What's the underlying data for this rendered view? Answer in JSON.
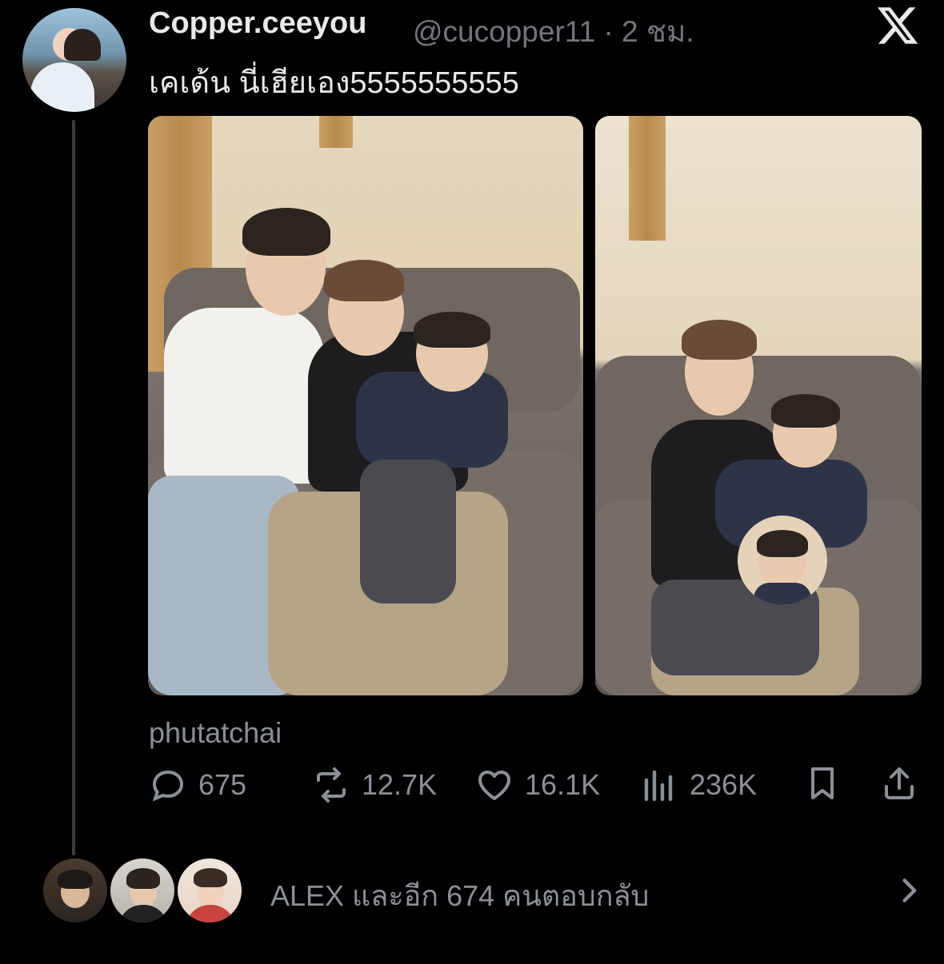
{
  "tweet": {
    "display_name": "Copper.ceeyou",
    "handle_time": "@cucopper11 · 2 ชม.",
    "text": "เคเด้น นี่เฮียเอง5555555555",
    "photo_credit": "phutatchai"
  },
  "actions": {
    "replies": "675",
    "reposts": "12.7K",
    "likes": "16.1K",
    "views": "236K"
  },
  "reply_summary": {
    "text": "ALEX และอีก 674 คนตอบกลับ"
  },
  "icons": {
    "platform": "x-logo-icon",
    "reply": "speech-bubble-icon",
    "repost": "repost-arrows-icon",
    "like": "heart-icon",
    "views": "bar-chart-icon",
    "bookmark": "bookmark-icon",
    "share": "share-upload-icon",
    "more": "chevron-right-icon"
  },
  "colors": {
    "background": "#000000",
    "primary_text": "#e7e9ea",
    "secondary_text": "#71767b"
  }
}
